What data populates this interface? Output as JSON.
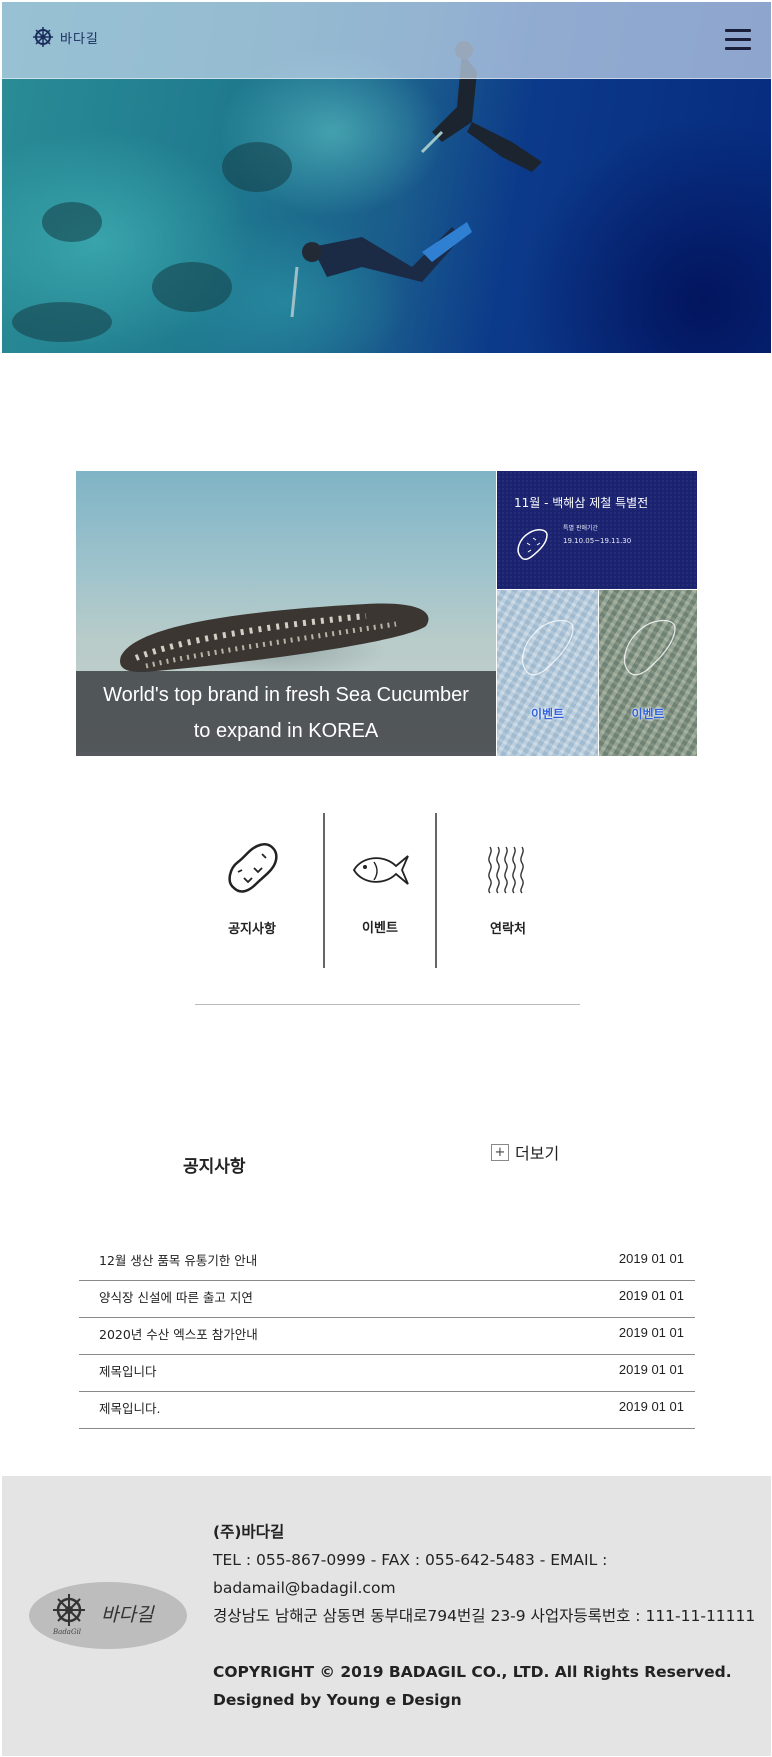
{
  "header": {
    "logo_text": "바다길"
  },
  "banner": {
    "caption_line1": "World's top brand in fresh Sea Cucumber",
    "caption_line2": "to expand in KOREA",
    "promo_title": "11월 - 백해삼 제철 특별전",
    "promo_sub1": "특별 판매기간",
    "promo_sub2": "19.10.05~19.11.30",
    "event1_label": "이벤트",
    "event2_label": "이벤트"
  },
  "quick_links": [
    {
      "label": "공지사항",
      "icon": "sea-cucumber-icon"
    },
    {
      "label": "이벤트",
      "icon": "fish-icon"
    },
    {
      "label": "연락처",
      "icon": "waves-icon"
    }
  ],
  "notices": {
    "title": "공지사항",
    "more_symbol": "+",
    "more_label": "더보기",
    "items": [
      {
        "title": "12월 생산 품목 유통기한 안내",
        "date": "2019 01 01"
      },
      {
        "title": "양식장 신설에 따른 출고 지연",
        "date": "2019 01 01"
      },
      {
        "title": "2020년 수산 엑스포 참가안내",
        "date": "2019 01 01"
      },
      {
        "title": "제목입니다",
        "date": "2019 01 01"
      },
      {
        "title": "제목입니다.",
        "date": "2019 01 01"
      }
    ]
  },
  "footer": {
    "logo_text": "바다길",
    "logo_sub": "BadaGil",
    "company": "(주)바다길",
    "contact": "TEL : 055-867-0999 - FAX : 055-642-5483 - EMAIL : badamail@badagil.com",
    "address": "경상남도 남해군 삼동면 동부대로794번길 23-9 사업자등록번호 : 111-11-11111",
    "copyright": "COPYRIGHT © 2019 BADAGIL CO., LTD. All Rights Reserved. Designed by Young e Design"
  },
  "colors": {
    "promo_bg": "#1b2370",
    "event_label": "#2f62d8",
    "footer_bg": "#e4e4e4"
  }
}
